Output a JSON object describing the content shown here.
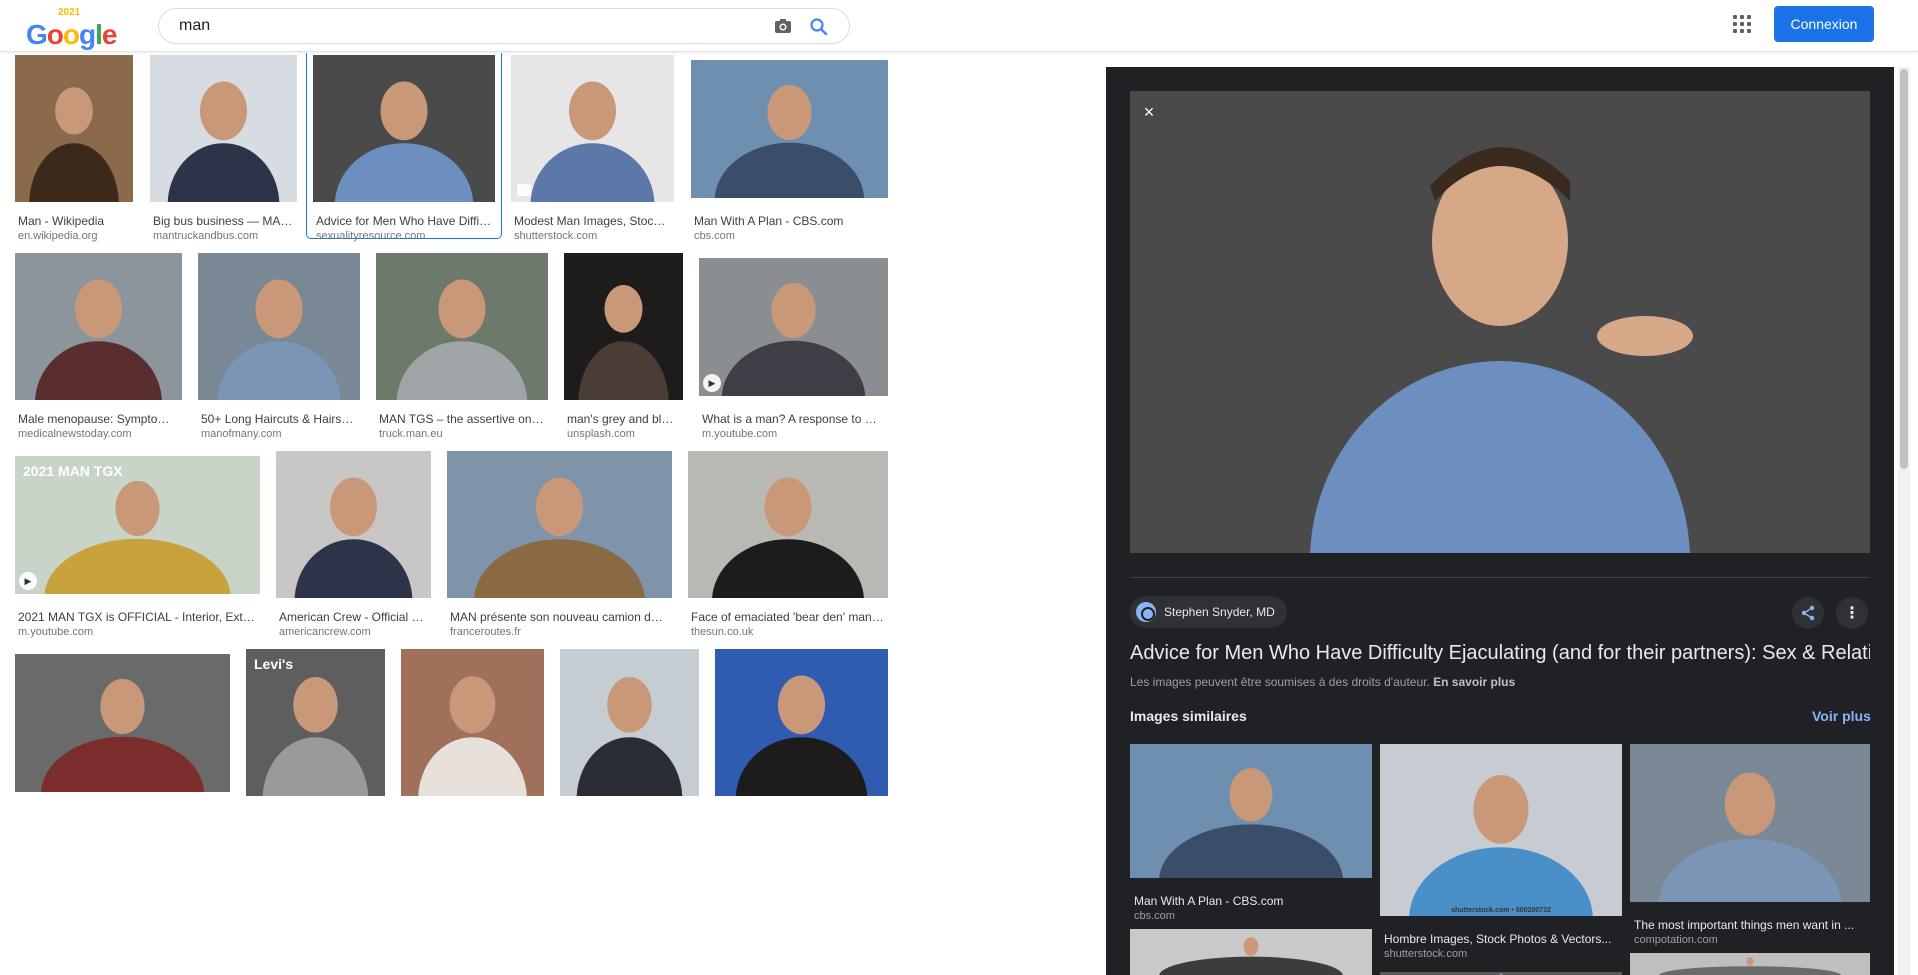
{
  "header": {
    "logo_text": "Google",
    "logo_badge": "2021",
    "search_value": "man",
    "connexion_label": "Connexion",
    "colors": {
      "blue": "#1a73e8",
      "panel_bg": "#202124",
      "link_blue": "#8ab4f8"
    }
  },
  "results": [
    {
      "caption": "Man - Wikipedia",
      "source": "en.wikipedia.org",
      "bg": "#8a6a4a",
      "fg": "#3b2a1c"
    },
    {
      "caption": "Big bus business — MAN Tru...",
      "source": "mantruckandbus.com",
      "bg": "#d7dce2",
      "fg": "#2b3448"
    },
    {
      "caption": "Advice for Men Who Have Difficulty E...",
      "source": "sexualityresource.com",
      "bg": "#4a4a4a",
      "fg": "#6d8fc0"
    },
    {
      "caption": "Modest Man Images, Stock Phot...",
      "source": "shutterstock.com",
      "bg": "#e6e6e6",
      "fg": "#5b78a8"
    },
    {
      "caption": "Man With A Plan - CBS.com",
      "source": "cbs.com",
      "bg": "#6e8fb0",
      "fg": "#3a4e6a"
    },
    {
      "caption": "Male menopause: Symptoms, cau...",
      "source": "medicalnewstoday.com",
      "bg": "#8c949c",
      "fg": "#5a2e2e"
    },
    {
      "caption": "50+ Long Haircuts & Hairstyle Ti...",
      "source": "manofmany.com",
      "bg": "#7a8896",
      "fg": "#7a95b5"
    },
    {
      "caption": "MAN TGS – the assertive one | MA...",
      "source": "truck.man.eu",
      "bg": "#6d7a6b",
      "fg": "#a0a5a8"
    },
    {
      "caption": "man's grey and black s...",
      "source": "unsplash.com",
      "bg": "#1e1c1b",
      "fg": "#4a3d36"
    },
    {
      "caption": "What is a man? A response to Gillette -...",
      "source": "m.youtube.com",
      "bg": "#8a8e92",
      "fg": "#3e3e46"
    },
    {
      "caption": "2021 MAN TGX is OFFICIAL - Interior, Exterior prese...",
      "source": "m.youtube.com",
      "bg": "#c9d4c9",
      "fg": "#c8a23a",
      "overlay_text": "2021 MAN TGX"
    },
    {
      "caption": "American Crew - Official Suppli...",
      "source": "americancrew.com",
      "bg": "#c9c7c5",
      "fg": "#2d3348"
    },
    {
      "caption": "MAN présente son nouveau camion de chantie...",
      "source": "franceroutes.fr",
      "bg": "#7f94a8",
      "fg": "#8a6a45"
    },
    {
      "caption": "Face of emaciated 'bear den' man reveale...",
      "source": "thesun.co.uk",
      "bg": "#b9b9b4",
      "fg": "#1c1c1c"
    },
    {
      "caption": "",
      "source": "",
      "bg": "#6a6a6a",
      "fg": "#7a2d2a"
    },
    {
      "caption": "",
      "source": "",
      "bg": "#5e5e5e",
      "fg": "#9a9a9a",
      "overlay_text": "Levi's"
    },
    {
      "caption": "",
      "source": "",
      "bg": "#a0705a",
      "fg": "#e8e0da"
    },
    {
      "caption": "",
      "source": "",
      "bg": "#c5cdd3",
      "fg": "#2a2e34"
    },
    {
      "caption": "",
      "source": "",
      "bg": "#2f5cb0",
      "fg": "#1c1c1c"
    }
  ],
  "preview": {
    "close_icon": "×",
    "author": "Stephen Snyder, MD",
    "title": "Advice for Men Who Have Difficulty Ejaculating (and for their partners): Sex & Relati",
    "copyright_text": "Les images peuvent être soumises à des droits d'auteur.",
    "copyright_link": "En savoir plus",
    "similar_label": "Images similaires",
    "voir_plus": "Voir plus",
    "main_bg": "#4a4a4a",
    "main_fg": "#6d8fc0"
  },
  "similar": [
    {
      "caption": "Man With A Plan - CBS.com",
      "source": "cbs.com",
      "bg": "#6e8fb0",
      "fg": "#3a4e6a"
    },
    {
      "caption": "Hombre Images, Stock Photos & Vectors...",
      "source": "shutterstock.com",
      "bg": "#c7ccd2",
      "fg": "#4a90c8",
      "overlay_text": "shutterstock.com • 600200732"
    },
    {
      "caption": "The most important things men want in ...",
      "source": "compotation.com",
      "bg": "#7a8896",
      "fg": "#7a95b5"
    },
    {
      "caption": "",
      "source": "",
      "bg": "#c9c9c9",
      "fg": "#3c3c3c"
    },
    {
      "caption": "",
      "source": "",
      "bg": "#5a5a5a",
      "fg": "#808080"
    },
    {
      "caption": "",
      "source": "",
      "bg": "#bfbfbf",
      "fg": "#6a6a6a"
    }
  ]
}
